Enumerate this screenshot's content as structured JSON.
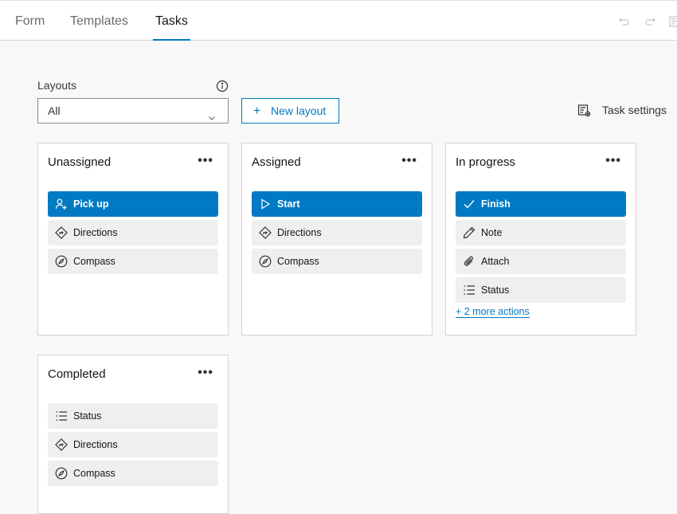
{
  "tabs": [
    {
      "label": "Form"
    },
    {
      "label": "Templates"
    },
    {
      "label": "Tasks",
      "active": true
    }
  ],
  "accent_color": "#007ac2",
  "layouts": {
    "label": "Layouts",
    "selected": "All",
    "new_layout_label": "New layout"
  },
  "task_settings_label": "Task settings",
  "cards": [
    {
      "title": "Unassigned",
      "actions": [
        {
          "label": "Pick up",
          "icon": "user-plus-icon",
          "primary": true
        },
        {
          "label": "Directions",
          "icon": "directions-icon"
        },
        {
          "label": "Compass",
          "icon": "compass-icon"
        }
      ]
    },
    {
      "title": "Assigned",
      "actions": [
        {
          "label": "Start",
          "icon": "play-icon",
          "primary": true
        },
        {
          "label": "Directions",
          "icon": "directions-icon"
        },
        {
          "label": "Compass",
          "icon": "compass-icon"
        }
      ]
    },
    {
      "title": "In progress",
      "actions": [
        {
          "label": "Finish",
          "icon": "check-icon",
          "primary": true
        },
        {
          "label": "Note",
          "icon": "pencil-icon"
        },
        {
          "label": "Attach",
          "icon": "paperclip-icon"
        },
        {
          "label": "Status",
          "icon": "list-icon"
        }
      ],
      "more_actions": "+ 2 more actions"
    },
    {
      "title": "Completed",
      "actions": [
        {
          "label": "Status",
          "icon": "list-icon"
        },
        {
          "label": "Directions",
          "icon": "directions-icon"
        },
        {
          "label": "Compass",
          "icon": "compass-icon"
        }
      ]
    }
  ]
}
